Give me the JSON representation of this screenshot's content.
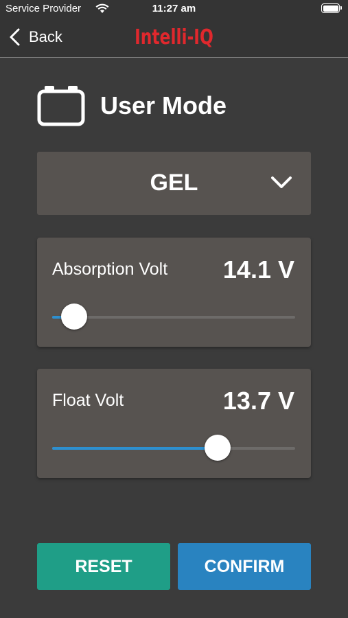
{
  "status_bar": {
    "carrier": "Service Provider",
    "time": "11:27 am",
    "icons": [
      "wifi-icon",
      "battery-icon"
    ]
  },
  "nav": {
    "back_label": "Back",
    "logo_text": "Intelli-IQ",
    "logo_color": "#e0282d"
  },
  "mode": {
    "title": "User Mode",
    "icon": "battery-outline-icon"
  },
  "battery_type": {
    "selected": "GEL",
    "icon": "chevron-down-icon"
  },
  "absorption": {
    "label": "Absorption Volt",
    "value_text": "14.1 V",
    "slider_fraction": 0.09
  },
  "float": {
    "label": "Float Volt",
    "value_text": "13.7 V",
    "slider_fraction": 0.68
  },
  "buttons": {
    "reset": "RESET",
    "confirm": "CONFIRM"
  },
  "colors": {
    "background": "#3b3b3b",
    "card": "#575350",
    "slider_active": "#2d8fcf",
    "reset": "#1f9e87",
    "confirm": "#2983c0"
  }
}
